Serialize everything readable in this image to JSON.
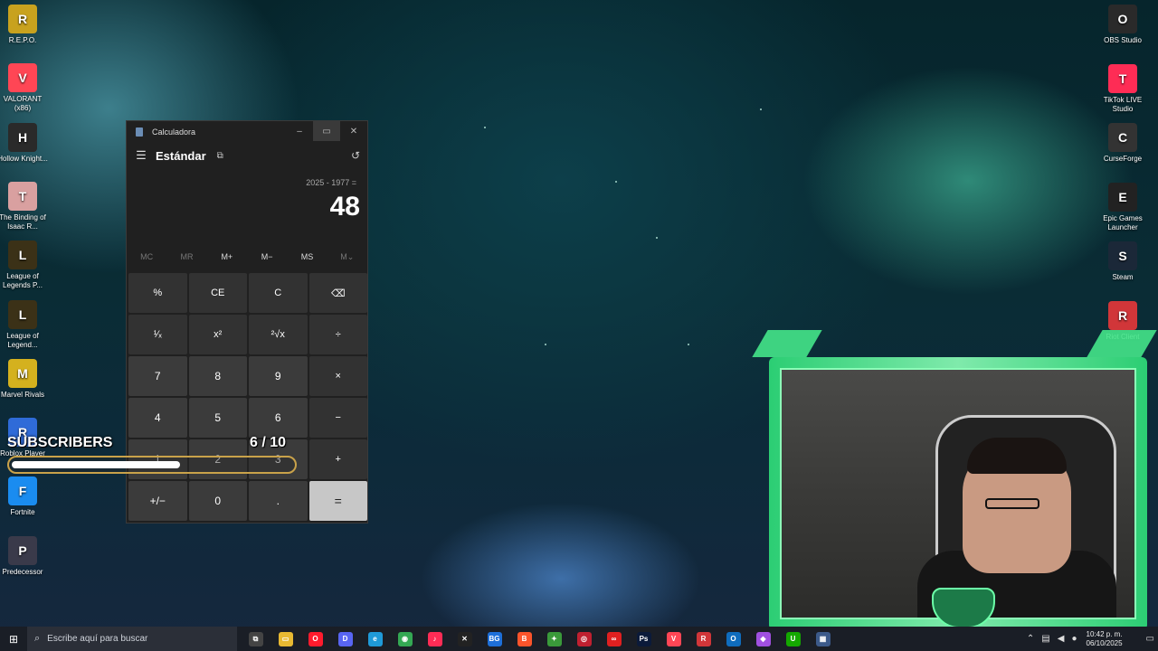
{
  "desktop": {
    "left_icons": [
      {
        "label": "R.E.P.O.",
        "icon": "repo-icon",
        "color": "#c8a21e"
      },
      {
        "label": "VALORANT (x86)",
        "icon": "valorant-icon",
        "color": "#ff4655"
      },
      {
        "label": "Hollow Knight...",
        "icon": "hollow-knight-icon",
        "color": "#2a2a2a"
      },
      {
        "label": "The Binding of Isaac R...",
        "icon": "isaac-icon",
        "color": "#d9a0a0"
      },
      {
        "label": "League of Legends P...",
        "icon": "lol-icon",
        "color": "#3b3117"
      },
      {
        "label": "League of Legend...",
        "icon": "lol-icon",
        "color": "#3b3117"
      },
      {
        "label": "Marvel Rivals",
        "icon": "marvel-rivals-icon",
        "color": "#d4b11e"
      },
      {
        "label": "Roblox Player",
        "icon": "roblox-icon",
        "color": "#2f6bd8"
      },
      {
        "label": "Fortnite",
        "icon": "fortnite-icon",
        "color": "#1a8cf0"
      },
      {
        "label": "Predecessor",
        "icon": "predecessor-icon",
        "color": "#3a3a4a"
      }
    ],
    "right_icons": [
      {
        "label": "OBS Studio",
        "icon": "obs-icon",
        "color": "#2a2a2a"
      },
      {
        "label": "TikTok LIVE Studio",
        "icon": "tiktok-icon",
        "color": "#fe2c55"
      },
      {
        "label": "CurseForge",
        "icon": "curseforge-icon",
        "color": "#333333"
      },
      {
        "label": "Epic Games Launcher",
        "icon": "epic-games-icon",
        "color": "#222222"
      },
      {
        "label": "Steam",
        "icon": "steam-icon",
        "color": "#1b2838"
      },
      {
        "label": "Riot Client",
        "icon": "riot-icon",
        "color": "#d13639"
      }
    ]
  },
  "calculator": {
    "title": "Calculadora",
    "mode": "Estándar",
    "expression": "2025 - 1977 =",
    "result": "48",
    "memory": [
      "MC",
      "MR",
      "M+",
      "M−",
      "MS",
      "M⌄"
    ],
    "keys": [
      [
        "%",
        "CE",
        "C",
        "⌫"
      ],
      [
        "¹⁄ₓ",
        "x²",
        "²√x",
        "÷"
      ],
      [
        "7",
        "8",
        "9",
        "×"
      ],
      [
        "4",
        "5",
        "6",
        "−"
      ],
      [
        "1",
        "2",
        "3",
        "+"
      ],
      [
        "+/−",
        "0",
        ".",
        "="
      ]
    ]
  },
  "overlay": {
    "label": "SUBSCRIBERS",
    "count": "6  / 10",
    "progress_fraction": 0.6
  },
  "taskbar": {
    "search_placeholder": "Escribe aquí para buscar",
    "time": "10:42 p. m.",
    "date": "06/10/2025",
    "apps": [
      {
        "icon": "task-view-icon",
        "color": "#444",
        "glyph": "⧉"
      },
      {
        "icon": "file-explorer-icon",
        "color": "#e8b932",
        "glyph": "▭"
      },
      {
        "icon": "opera-icon",
        "color": "#ff1b2d",
        "glyph": "O"
      },
      {
        "icon": "discord-icon",
        "color": "#5865f2",
        "glyph": "D"
      },
      {
        "icon": "edge-icon",
        "color": "#1f9ad8",
        "glyph": "e"
      },
      {
        "icon": "chrome-icon",
        "color": "#34a853",
        "glyph": "◉"
      },
      {
        "icon": "tiktok-icon",
        "color": "#fe2c55",
        "glyph": "♪"
      },
      {
        "icon": "capcut-icon",
        "color": "#222",
        "glyph": "✕"
      },
      {
        "icon": "bg-icon",
        "color": "#1e6fd8",
        "glyph": "BG"
      },
      {
        "icon": "brave-icon",
        "color": "#fb542b",
        "glyph": "B"
      },
      {
        "icon": "green-app-icon",
        "color": "#3a9a3a",
        "glyph": "✦"
      },
      {
        "icon": "red-app-icon",
        "color": "#c02030",
        "glyph": "◎"
      },
      {
        "icon": "red-circle-icon",
        "color": "#e02020",
        "glyph": "∞"
      },
      {
        "icon": "photoshop-icon",
        "color": "#0b1a3a",
        "glyph": "Ps"
      },
      {
        "icon": "valorant-icon",
        "color": "#ff4655",
        "glyph": "V"
      },
      {
        "icon": "riot-icon",
        "color": "#d13639",
        "glyph": "R"
      },
      {
        "icon": "outlook-icon",
        "color": "#0f6cbd",
        "glyph": "O"
      },
      {
        "icon": "color-app-icon",
        "color": "#a050e0",
        "glyph": "◆"
      },
      {
        "icon": "upwork-icon",
        "color": "#14a800",
        "glyph": "U"
      },
      {
        "icon": "calculator-icon",
        "color": "#3c5a8a",
        "glyph": "▦"
      }
    ]
  }
}
